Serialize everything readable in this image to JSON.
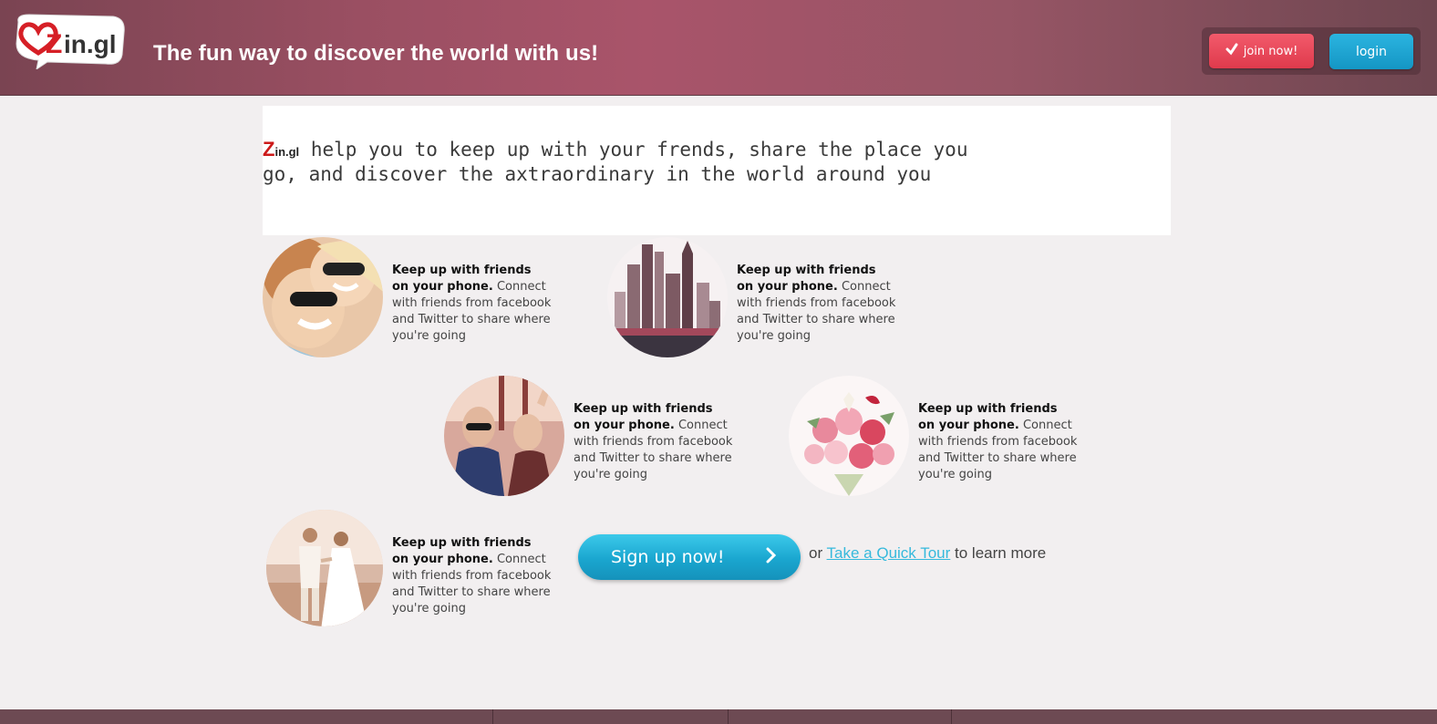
{
  "header": {
    "logo_text": "Zin.gl",
    "tagline": "The fun way to discover the world with us!",
    "join_label": "join now!",
    "login_label": "login"
  },
  "intro": {
    "brand_first": "Z",
    "brand_rest": "in.gl",
    "text": " help you to keep up with your frends, share the place you go, and discover the axtraordinary in the world around you"
  },
  "features": [
    {
      "title": "Keep up with friends on your phone.",
      "body": " Connect with friends from facebook and Twitter to share where you're going",
      "image": "friends-selfie"
    },
    {
      "title": "Keep up with friends on your phone.",
      "body": " Connect with friends from facebook and Twitter to share where you're going",
      "image": "city-skyline"
    },
    {
      "title": "Keep up with friends on your phone.",
      "body": " Connect with friends from facebook and Twitter to share where you're going",
      "image": "party-crowd"
    },
    {
      "title": "Keep up with friends on your phone.",
      "body": " Connect with friends from facebook and Twitter to share where you're going",
      "image": "flower-bouquet"
    },
    {
      "title": "Keep up with friends on your phone.",
      "body": " Connect with friends from facebook and Twitter to share where you're going",
      "image": "wedding-couple"
    }
  ],
  "cta": {
    "signup_label": "Sign up now!",
    "or_text": "or ",
    "tour_link": "Take a Quick Tour",
    "after_text": " to learn more"
  },
  "colors": {
    "header": "#a9546a",
    "join": "#e8475a",
    "login": "#1ea6d2",
    "link": "#35b9dc",
    "brand_red": "#cc1a1a"
  }
}
